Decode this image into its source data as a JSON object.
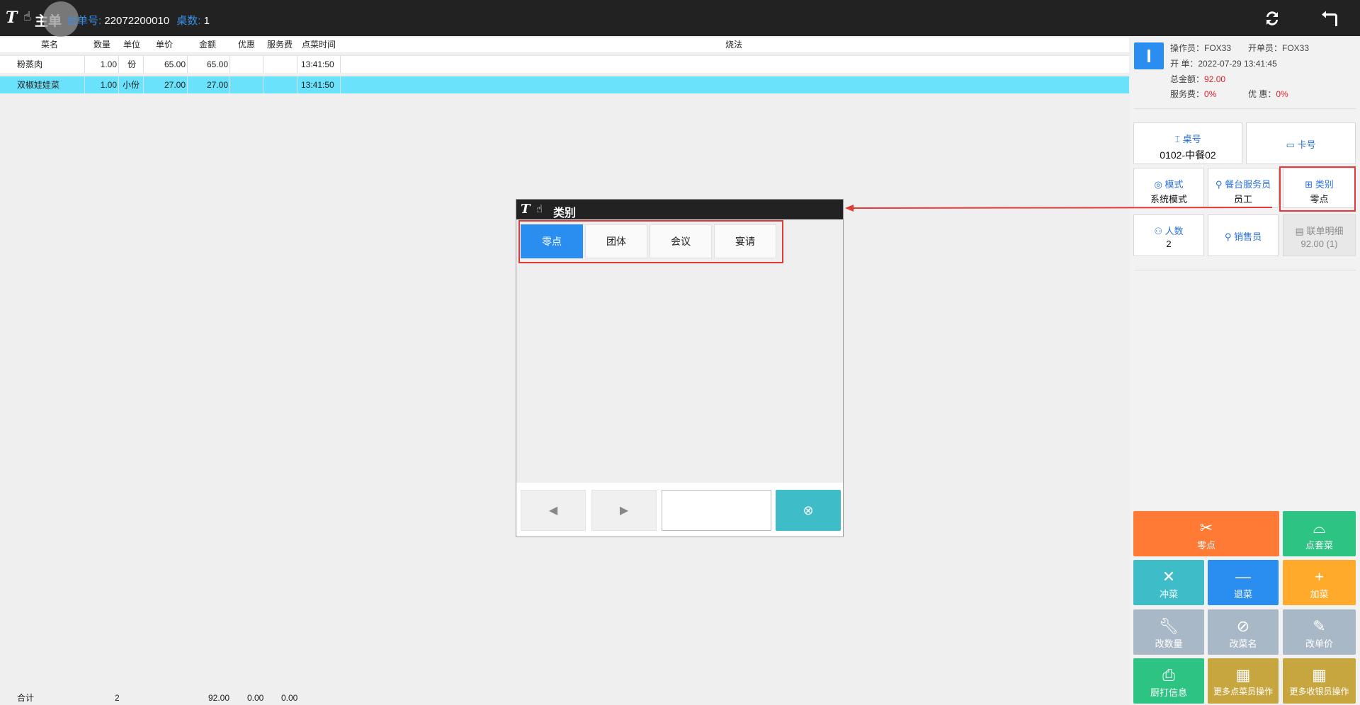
{
  "header": {
    "logo": "T",
    "title": "主单",
    "order_label": "台单号:",
    "order_no": "22072200010",
    "table_count_label": "桌数:",
    "table_count": "1",
    "refresh_icon": "refresh-icon",
    "back_icon": "back-icon"
  },
  "table": {
    "columns": [
      "菜名",
      "数量",
      "单位",
      "单价",
      "金额",
      "优惠",
      "服务费",
      "点菜时间",
      "烧法"
    ],
    "rows": [
      {
        "name": "粉蒸肉",
        "qty": "1.00",
        "unit": "份",
        "price": "65.00",
        "amount": "65.00",
        "discount": "",
        "service": "",
        "time": "13:41:50",
        "method": ""
      },
      {
        "name": "双椒娃娃菜",
        "qty": "1.00",
        "unit": "小份",
        "price": "27.00",
        "amount": "27.00",
        "discount": "",
        "service": "",
        "time": "13:41:50",
        "method": ""
      }
    ],
    "footer": {
      "label": "合计",
      "qty": "2",
      "amount": "92.00",
      "discount": "0.00",
      "service": "0.00"
    }
  },
  "info": {
    "avatar": "I",
    "operator_label": "操作员：",
    "operator": "FOX33",
    "opener_label": "开单员：",
    "opener": "FOX33",
    "open_label": "开  单：",
    "open_time": "2022-07-29 13:41:45",
    "total_label": "总金额：",
    "total": "92.00",
    "service_label": "服务费：",
    "service": "0%",
    "discount_label": "优  惠：",
    "discount": "0%"
  },
  "cards": {
    "table_no": {
      "title": "桌号",
      "value": "0102-中餐02"
    },
    "card_no": {
      "title": "卡号",
      "value": ""
    },
    "mode": {
      "title": "模式",
      "value": "系统模式"
    },
    "waiter": {
      "title": "餐台服务员",
      "value": "员工"
    },
    "category": {
      "title": "类别",
      "value": "零点"
    },
    "people": {
      "title": "人数",
      "value": "2"
    },
    "seller": {
      "title": "销售员",
      "value": ""
    },
    "linked": {
      "title": "联单明细",
      "value": "92.00 (1)"
    }
  },
  "actions": {
    "a1": "零点",
    "a2": "点套菜",
    "a3": "冲菜",
    "a4": "退菜",
    "a5": "加菜",
    "a6": "改数量",
    "a7": "改菜名",
    "a8": "改单价",
    "a9": "厨打信息",
    "a10": "更多点菜员操作",
    "a11": "更多收银员操作"
  },
  "dialog": {
    "title": "类别",
    "options": [
      "零点",
      "团体",
      "会议",
      "宴请"
    ],
    "input_value": ""
  },
  "colors": {
    "accent": "#2a8df0",
    "selected_row": "#6be2fb",
    "orange": "#ff7a34",
    "green": "#2dc483",
    "teal": "#3ebcc8",
    "blue_action": "#2a8df0",
    "amber": "#ffaa2a",
    "gray_action": "#a9b8c6",
    "gold": "#c7a640",
    "highlight": "#e53935"
  }
}
